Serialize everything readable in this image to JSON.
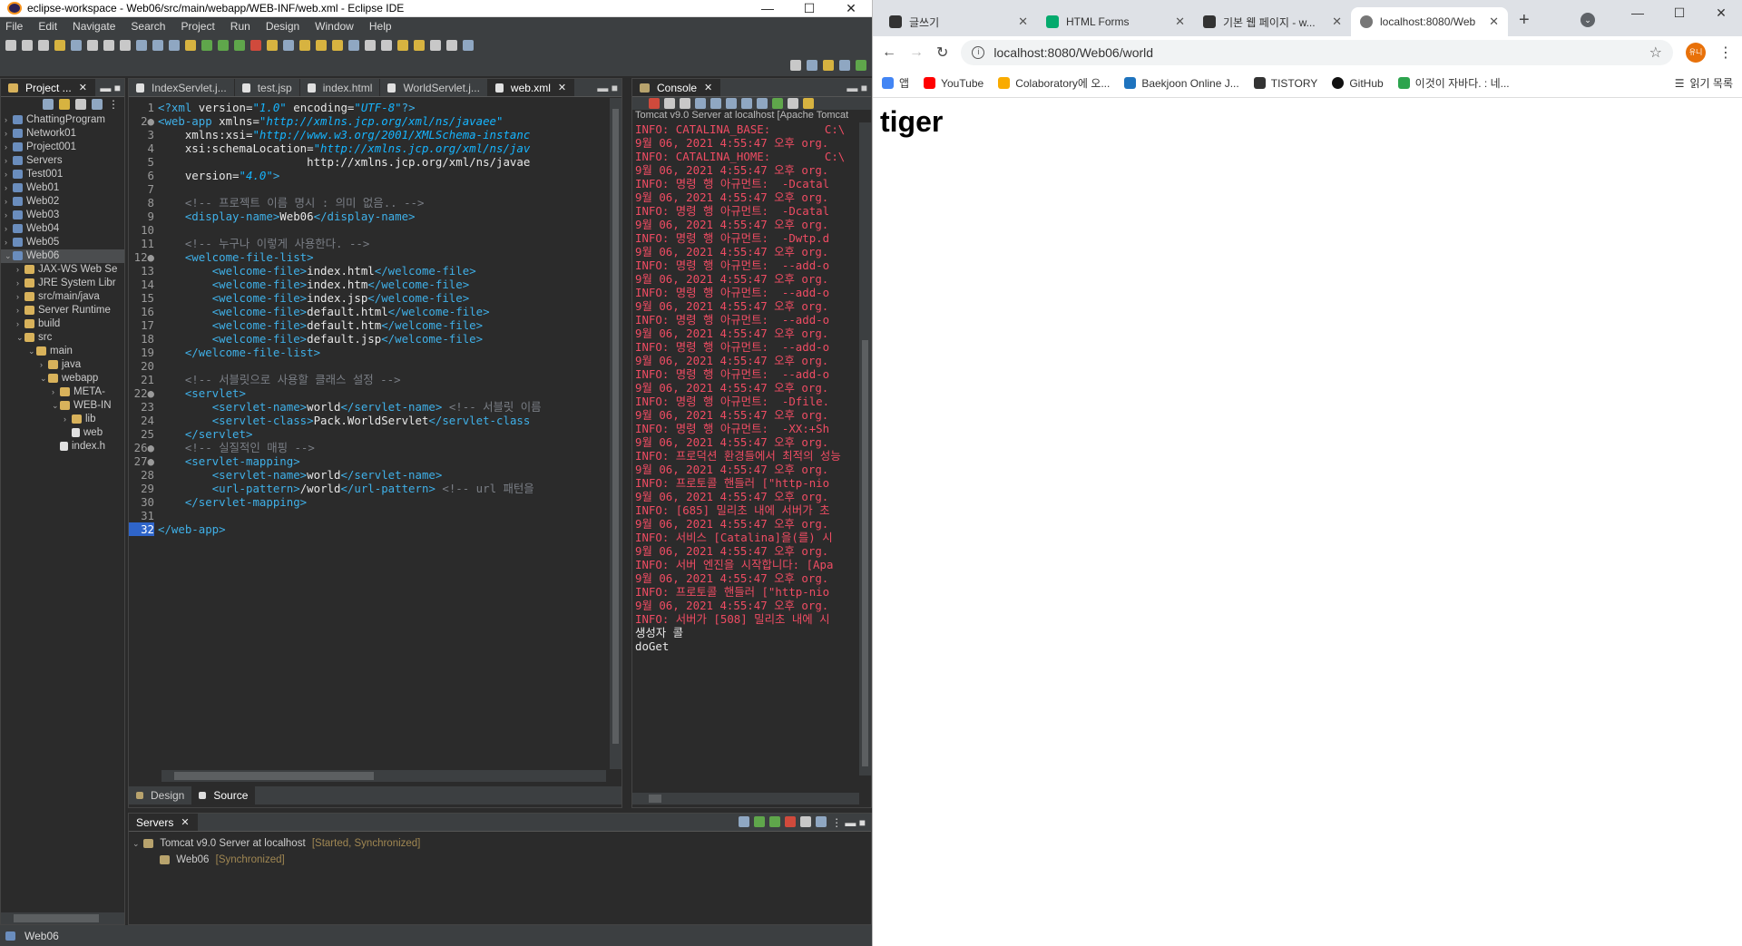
{
  "eclipse": {
    "window_title": "eclipse-workspace - Web06/src/main/webapp/WEB-INF/web.xml - Eclipse IDE",
    "menu": [
      "File",
      "Edit",
      "Navigate",
      "Search",
      "Project",
      "Run",
      "Design",
      "Window",
      "Help"
    ],
    "explorer": {
      "tab_label": "Project ...",
      "items": [
        {
          "label": "ChattingProgram",
          "level": 0,
          "expanded": false
        },
        {
          "label": "Network01",
          "level": 0,
          "expanded": false
        },
        {
          "label": "Project001",
          "level": 0,
          "expanded": false
        },
        {
          "label": "Servers",
          "level": 0,
          "expanded": false
        },
        {
          "label": "Test001",
          "level": 0,
          "expanded": false
        },
        {
          "label": "Web01",
          "level": 0,
          "expanded": false
        },
        {
          "label": "Web02",
          "level": 0,
          "expanded": false
        },
        {
          "label": "Web03",
          "level": 0,
          "expanded": false
        },
        {
          "label": "Web04",
          "level": 0,
          "expanded": false
        },
        {
          "label": "Web05",
          "level": 0,
          "expanded": false
        },
        {
          "label": "Web06",
          "level": 0,
          "expanded": true,
          "selected": true
        },
        {
          "label": "JAX-WS Web Se",
          "level": 1,
          "expanded": false
        },
        {
          "label": "JRE System Libr",
          "level": 1,
          "expanded": false
        },
        {
          "label": "src/main/java",
          "level": 1,
          "expanded": false
        },
        {
          "label": "Server Runtime",
          "level": 1,
          "expanded": false
        },
        {
          "label": "build",
          "level": 1,
          "expanded": false
        },
        {
          "label": "src",
          "level": 1,
          "expanded": true
        },
        {
          "label": "main",
          "level": 2,
          "expanded": true
        },
        {
          "label": "java",
          "level": 3,
          "expanded": false
        },
        {
          "label": "webapp",
          "level": 3,
          "expanded": true
        },
        {
          "label": "META-",
          "level": 4,
          "expanded": false
        },
        {
          "label": "WEB-IN",
          "level": 4,
          "expanded": true
        },
        {
          "label": "lib",
          "level": 5,
          "expanded": false
        },
        {
          "label": "web",
          "level": 5,
          "file": true
        },
        {
          "label": "index.h",
          "level": 4,
          "file": true
        }
      ]
    },
    "editor_tabs": [
      {
        "label": "IndexServlet.j...",
        "active": false
      },
      {
        "label": "test.jsp",
        "active": false
      },
      {
        "label": "index.html",
        "active": false
      },
      {
        "label": "WorldServlet.j...",
        "active": false
      },
      {
        "label": "web.xml",
        "active": true
      }
    ],
    "code_lines": [
      "<?xml version=\"1.0\" encoding=\"UTF-8\"?>",
      "<web-app xmlns=\"http://xmlns.jcp.org/xml/ns/javaee\"",
      "    xmlns:xsi=\"http://www.w3.org/2001/XMLSchema-instanc",
      "    xsi:schemaLocation=\"http://xmlns.jcp.org/xml/ns/jav",
      "                      http://xmlns.jcp.org/xml/ns/javae",
      "    version=\"4.0\">",
      "",
      "    <!-- 프로젝트 이름 명시 : 의미 없음.. -->",
      "    <display-name>Web06</display-name>",
      "",
      "    <!-- 누구나 이렇게 사용한다. -->",
      "    <welcome-file-list>",
      "        <welcome-file>index.html</welcome-file>",
      "        <welcome-file>index.htm</welcome-file>",
      "        <welcome-file>index.jsp</welcome-file>",
      "        <welcome-file>default.html</welcome-file>",
      "        <welcome-file>default.htm</welcome-file>",
      "        <welcome-file>default.jsp</welcome-file>",
      "    </welcome-file-list>",
      "",
      "    <!-- 서블릿으로 사용할 클래스 설정 -->",
      "    <servlet>",
      "        <servlet-name>world</servlet-name> <!-- 서블릿 이름",
      "        <servlet-class>Pack.WorldServlet</servlet-class",
      "    </servlet>",
      "    <!-- 실질적인 매핑 -->",
      "    <servlet-mapping>",
      "        <servlet-name>world</servlet-name>",
      "        <url-pattern>/world</url-pattern> <!-- url 패턴을",
      "    </servlet-mapping>",
      "",
      "</web-app>"
    ],
    "fold_markers": [
      2,
      12,
      22,
      26,
      27
    ],
    "editor_bottom_tabs": [
      "Design",
      "Source"
    ],
    "console": {
      "tab_label": "Console",
      "header": "Tomcat v9.0 Server at localhost [Apache Tomcat",
      "lines": [
        "INFO: CATALINA_BASE:        C:\\",
        "9월 06, 2021 4:55:47 오후 org.",
        "INFO: CATALINA_HOME:        C:\\",
        "9월 06, 2021 4:55:47 오후 org.",
        "INFO: 명령 행 아규먼트:  -Dcatal",
        "9월 06, 2021 4:55:47 오후 org.",
        "INFO: 명령 행 아규먼트:  -Dcatal",
        "9월 06, 2021 4:55:47 오후 org.",
        "INFO: 명령 행 아규먼트:  -Dwtp.d",
        "9월 06, 2021 4:55:47 오후 org.",
        "INFO: 명령 행 아규먼트:  --add-o",
        "9월 06, 2021 4:55:47 오후 org.",
        "INFO: 명령 행 아규먼트:  --add-o",
        "9월 06, 2021 4:55:47 오후 org.",
        "INFO: 명령 행 아규먼트:  --add-o",
        "9월 06, 2021 4:55:47 오후 org.",
        "INFO: 명령 행 아규먼트:  --add-o",
        "9월 06, 2021 4:55:47 오후 org.",
        "INFO: 명령 행 아규먼트:  --add-o",
        "9월 06, 2021 4:55:47 오후 org.",
        "INFO: 명령 행 아규먼트:  -Dfile.",
        "9월 06, 2021 4:55:47 오후 org.",
        "INFO: 명령 행 아규먼트:  -XX:+Sh",
        "9월 06, 2021 4:55:47 오후 org.",
        "INFO: 프로덕션 환경들에서 최적의 성능",
        "9월 06, 2021 4:55:47 오후 org.",
        "INFO: 프로토콜 핸들러 [\"http-nio",
        "9월 06, 2021 4:55:47 오후 org.",
        "INFO: [685] 밀리초 내에 서버가 초",
        "9월 06, 2021 4:55:47 오후 org.",
        "INFO: 서비스 [Catalina]을(를) 시",
        "9월 06, 2021 4:55:47 오후 org.",
        "INFO: 서버 엔진을 시작합니다: [Apa",
        "9월 06, 2021 4:55:47 오후 org.",
        "INFO: 프로토콜 핸들러 [\"http-nio",
        "9월 06, 2021 4:55:47 오후 org.",
        "INFO: 서버가 [508] 밀리초 내에 시"
      ],
      "output_lines": [
        "생성자 콜",
        "doGet"
      ]
    },
    "servers": {
      "tab_label": "Servers",
      "server_name": "Tomcat v9.0 Server at localhost",
      "server_state": "[Started, Synchronized]",
      "module_name": "Web06",
      "module_state": "[Synchronized]"
    },
    "status_project": "Web06"
  },
  "chrome": {
    "tabs": [
      {
        "label": "글쓰기",
        "active": false,
        "favicon": "tistory-icon"
      },
      {
        "label": "HTML Forms",
        "active": false,
        "favicon": "w3schools-icon"
      },
      {
        "label": "기본 웹 페이지 - w...",
        "active": false,
        "favicon": "tistory-icon"
      },
      {
        "label": "localhost:8080/Web",
        "active": true,
        "favicon": "globe-icon"
      }
    ],
    "address": "localhost:8080/Web06/world",
    "profile_initials": "유니",
    "bookmarks": [
      {
        "label": "앱",
        "icon": "apps-grid-icon"
      },
      {
        "label": "YouTube",
        "icon": "youtube-icon"
      },
      {
        "label": "Colaboratory에 오...",
        "icon": "colab-icon"
      },
      {
        "label": "Baekjoon Online J...",
        "icon": "code-icon"
      },
      {
        "label": "TISTORY",
        "icon": "tistory-icon"
      },
      {
        "label": "GitHub",
        "icon": "github-icon"
      },
      {
        "label": "이것이 자바다. : 네...",
        "icon": "bookmark-icon"
      }
    ],
    "reading_list": "읽기 목록",
    "page_heading": "tiger"
  },
  "colors": {
    "eclipse_bg": "#2b2b2b",
    "console_red": "#ef4c63",
    "xml_tag": "#3fb0e8",
    "comment": "#7a7e85",
    "chrome_tabbar": "#dee1e6"
  }
}
